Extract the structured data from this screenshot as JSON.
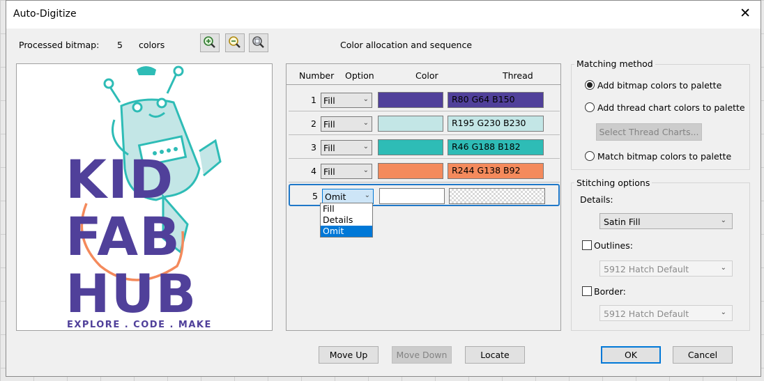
{
  "window": {
    "title": "Auto-Digitize",
    "close_glyph": "✕"
  },
  "header": {
    "processed_label": "Processed bitmap:",
    "color_count": "5",
    "colors_label": "colors",
    "allocation_label": "Color allocation and sequence"
  },
  "zoom": {
    "icons": [
      "zoom-in-icon",
      "zoom-out-icon",
      "zoom-fit-icon"
    ]
  },
  "preview": {
    "line1": "KID",
    "line2": "FAB",
    "line3": "HUB",
    "tagline": "EXPLORE . CODE . MAKE"
  },
  "table": {
    "headers": {
      "number": "Number",
      "option": "Option",
      "color": "Color",
      "thread": "Thread"
    },
    "rows": [
      {
        "num": "1",
        "option": "Fill",
        "color": "#50409a",
        "thread": "R80 G64 B150"
      },
      {
        "num": "2",
        "option": "Fill",
        "color": "#c3e6e6",
        "thread": "R195 G230 B230"
      },
      {
        "num": "3",
        "option": "Fill",
        "color": "#2ebcb6",
        "thread": "R46 G188 B182"
      },
      {
        "num": "4",
        "option": "Fill",
        "color": "#f48a5c",
        "thread": "R244 G138 B92"
      },
      {
        "num": "5",
        "option": "Omit",
        "color": "#ffffff",
        "thread": ""
      }
    ],
    "dropdown_options": [
      "Fill",
      "Details",
      "Omit"
    ],
    "dropdown_selected": "Omit"
  },
  "matching": {
    "title": "Matching method",
    "opt1": "Add bitmap colors to palette",
    "opt2": "Add thread chart colors to palette",
    "select_btn": "Select Thread Charts...",
    "opt3": "Match bitmap colors to palette",
    "selected": "Add bitmap colors to palette"
  },
  "stitching": {
    "title": "Stitching options",
    "details_label": "Details:",
    "details_value": "Satin Fill",
    "outlines_label": "Outlines:",
    "outlines_value": "5912 Hatch Default",
    "border_label": "Border:",
    "border_value": "5912 Hatch Default"
  },
  "buttons": {
    "move_up": "Move Up",
    "move_down": "Move Down",
    "locate": "Locate",
    "ok": "OK",
    "cancel": "Cancel"
  }
}
